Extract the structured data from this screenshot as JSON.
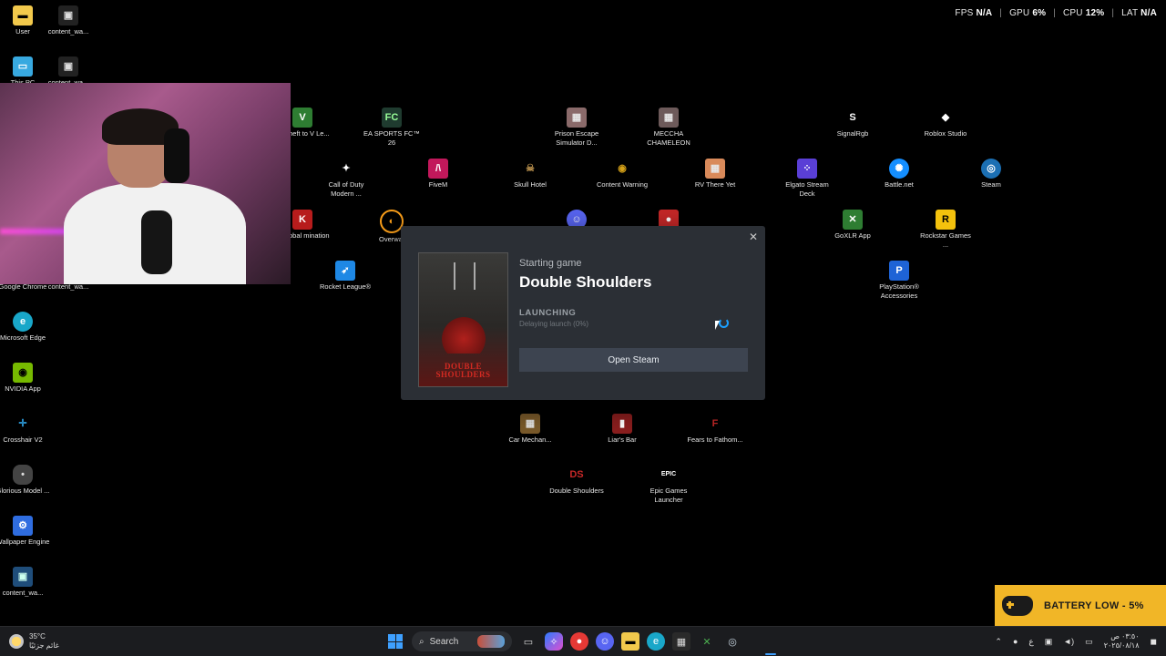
{
  "overlay": {
    "fps_label": "FPS",
    "fps_value": "N/A",
    "gpu_label": "GPU",
    "gpu_value": "6%",
    "cpu_label": "CPU",
    "cpu_value": "12%",
    "lat_label": "LAT",
    "lat_value": "N/A"
  },
  "desktop_icons": [
    {
      "label": "User",
      "icon": "folder-icon",
      "color": "#f2c94c"
    },
    {
      "label": "content_wa...",
      "icon": "app-icon",
      "color": "#222222"
    },
    {
      "label": "This PC",
      "icon": "monitor-icon",
      "color": "#38a9e0"
    },
    {
      "label": "content_wa...",
      "icon": "app-icon",
      "color": "#222222"
    },
    {
      "label": "Google Chrome",
      "icon": "chrome-icon",
      "color": "#e53935"
    },
    {
      "label": "content_wa...",
      "icon": "app-icon",
      "color": "#222222"
    },
    {
      "label": "Microsoft Edge",
      "icon": "edge-icon",
      "color": "#19a7c9"
    },
    {
      "label": "NVIDIA App",
      "icon": "nvidia-icon",
      "color": "#76b900"
    },
    {
      "label": "Crosshair V2",
      "icon": "crosshair-icon",
      "color": "#2d9cdb"
    },
    {
      "label": "Glorious Model ...",
      "icon": "mouse-icon",
      "color": "#444444"
    },
    {
      "label": "Wallpaper Engine",
      "icon": "wallpaper-icon",
      "color": "#2f6de0"
    },
    {
      "label": "content_wa...",
      "icon": "app-icon",
      "color": "#1f4d7a"
    },
    {
      "label": "nd Theft to V Le...",
      "icon": "gta-icon",
      "color": "#2e7d32"
    },
    {
      "label": "EA SPORTS FC™ 26",
      "icon": "ea-icon",
      "color": "#1f3b2f"
    },
    {
      "label": "Prison Escape Simulator D...",
      "icon": "game-icon",
      "color": "#8a6a6a"
    },
    {
      "label": "MECCHA CHAMELEON",
      "icon": "game-icon",
      "color": "#6d5a5a"
    },
    {
      "label": "SignalRgb",
      "icon": "signalrgb-icon",
      "color": "#ffffff"
    },
    {
      "label": "Roblox Studio",
      "icon": "roblox-icon",
      "color": "#ffffff"
    },
    {
      "label": "Call of Duty Modern ...",
      "icon": "cod-icon",
      "color": "#ffffff"
    },
    {
      "label": "FiveM",
      "icon": "fivem-icon",
      "color": "#c2185b"
    },
    {
      "label": "Skull Hotel",
      "icon": "game-icon",
      "color": "#b38b4a"
    },
    {
      "label": "Content Warning",
      "icon": "game-icon",
      "color": "#d4a017"
    },
    {
      "label": "RV There Yet",
      "icon": "game-icon",
      "color": "#d98a5a"
    },
    {
      "label": "Elgato Stream Deck",
      "icon": "streamdeck-icon",
      "color": "#5a3fd6"
    },
    {
      "label": "Battle.net",
      "icon": "battlenet-icon",
      "color": "#148eff"
    },
    {
      "label": "Steam",
      "icon": "steam-icon",
      "color": "#1b6fb3"
    },
    {
      "label": "K Global mination",
      "icon": "game-icon",
      "color": "#b71c1c"
    },
    {
      "label": "Overwat",
      "icon": "overwatch-icon",
      "color": "#f99e1a"
    },
    {
      "label": "GoXLR App",
      "icon": "goxlr-icon",
      "color": "#2e7d32"
    },
    {
      "label": "Rockstar Games ...",
      "icon": "rockstar-icon",
      "color": "#f4c20d"
    },
    {
      "label": "Rocket League®",
      "icon": "rocketleague-icon",
      "color": "#1e88e5"
    },
    {
      "label": "PlayStation® Accessories",
      "icon": "playstation-icon",
      "color": "#1e63d6"
    },
    {
      "label": "Car Mechan...",
      "icon": "game-icon",
      "color": "#7a5a2a"
    },
    {
      "label": "Liar's Bar",
      "icon": "game-icon",
      "color": "#8b1e1e"
    },
    {
      "label": "Fears to Fathom...",
      "icon": "game-icon",
      "color": "#c62828"
    },
    {
      "label": "Double Shoulders",
      "icon": "game-icon",
      "color": "#c62828"
    },
    {
      "label": "Epic Games Launcher",
      "icon": "epic-icon",
      "color": "#ffffff"
    },
    {
      "label": "",
      "icon": "discord-icon",
      "color": "#5865f2"
    },
    {
      "label": "",
      "icon": "amongus-icon",
      "color": "#c62828"
    }
  ],
  "dialog": {
    "starting_label": "Starting game",
    "game_title": "Double Shoulders",
    "status": "LAUNCHING",
    "substatus": "Delaying launch (0%)",
    "button_label": "Open Steam",
    "cover_title_line1": "DOUBLE",
    "cover_title_line2": "SHOULDERS",
    "accent_color": "#1a9fff"
  },
  "battery": {
    "text": "BATTERY LOW - 5%"
  },
  "taskbar": {
    "weather_temp": "35°C",
    "weather_desc": "غائم جزئيًا",
    "search_label": "Search",
    "language": "ع",
    "time": "٠٣:٥٠ ص",
    "date": "٢٠٢٥/٠٨/١٨"
  }
}
